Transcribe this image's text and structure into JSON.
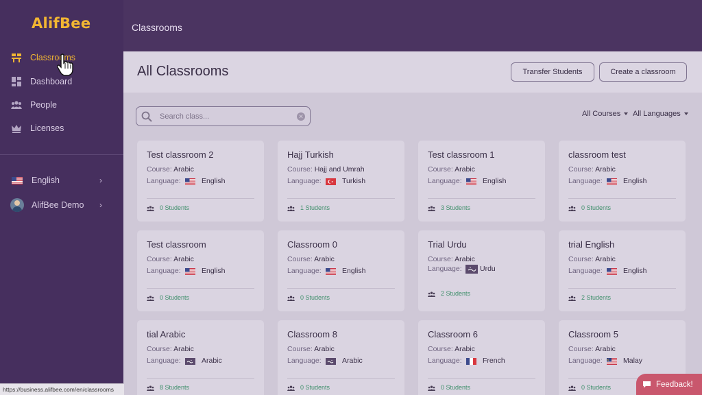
{
  "app": {
    "logo": "AlifBee"
  },
  "sidebar": {
    "nav": [
      {
        "label": "Classrooms",
        "icon": "classroom-icon",
        "active": true
      },
      {
        "label": "Dashboard",
        "icon": "dashboard-icon",
        "active": false
      },
      {
        "label": "People",
        "icon": "people-icon",
        "active": false
      },
      {
        "label": "Licenses",
        "icon": "crown-icon",
        "active": false
      }
    ],
    "language": {
      "label": "English",
      "icon": "us-flag-icon"
    },
    "account": {
      "label": "AlifBee Demo",
      "icon": "avatar"
    }
  },
  "topbar": {
    "title": "Classrooms"
  },
  "main": {
    "heading": "All Classrooms",
    "transfer_button": "Transfer Students",
    "create_button": "Create a classroom",
    "search": {
      "placeholder": "Search class...",
      "value": ""
    },
    "filters": {
      "courses": "All Courses",
      "languages": "All Languages"
    },
    "course_prefix": "Course:",
    "language_prefix": "Language:",
    "classrooms": [
      {
        "name": "Test classroom 2",
        "course": "Arabic",
        "language": "English",
        "flag": "us",
        "students": "0 Students"
      },
      {
        "name": "Hajj Turkish",
        "course": "Hajj and Umrah",
        "language": "Turkish",
        "flag": "tr",
        "students": "1 Students"
      },
      {
        "name": "Test classroom 1",
        "course": "Arabic",
        "language": "English",
        "flag": "us",
        "students": "3 Students"
      },
      {
        "name": "classroom test",
        "course": "Arabic",
        "language": "English",
        "flag": "us",
        "students": "0 Students"
      },
      {
        "name": "Test classroom",
        "course": "Arabic",
        "language": "English",
        "flag": "us",
        "students": "0 Students"
      },
      {
        "name": "Classroom 0",
        "course": "Arabic",
        "language": "English",
        "flag": "us",
        "students": "0 Students"
      },
      {
        "name": "Trial Urdu",
        "course": "Arabic",
        "language": "Urdu",
        "flag": "urdu",
        "students": "2 Students"
      },
      {
        "name": "trial English",
        "course": "Arabic",
        "language": "English",
        "flag": "us",
        "students": "2 Students"
      },
      {
        "name": "tial Arabic",
        "course": "Arabic",
        "language": "Arabic",
        "flag": "arabic",
        "students": "8 Students"
      },
      {
        "name": "Classroom 8",
        "course": "Arabic",
        "language": "Arabic",
        "flag": "arabic",
        "students": "0 Students"
      },
      {
        "name": "Classroom 6",
        "course": "Arabic",
        "language": "French",
        "flag": "fr",
        "students": "0 Students"
      },
      {
        "name": "Classroom 5",
        "course": "Arabic",
        "language": "Malay",
        "flag": "my",
        "students": "0 Students"
      }
    ]
  },
  "feedback": {
    "label": "Feedback!"
  },
  "statusbar": {
    "url": "https://business.alifbee.com/en/classrooms"
  },
  "colors": {
    "accent": "#f2b632",
    "sidebar": "#462f5e",
    "students": "#3f8f6b",
    "feedback": "#c9576d"
  }
}
